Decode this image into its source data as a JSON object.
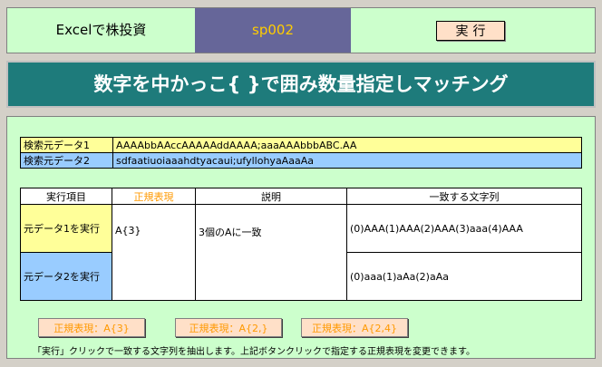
{
  "topbar": {
    "title": "Excelで株投資",
    "code": "sp002",
    "run_label": "実行"
  },
  "banner": {
    "title": "数字を中かっこ{ }で囲み数量指定しマッチング"
  },
  "source": {
    "rows": [
      {
        "label": "検索元データ1",
        "value": "AAAAbbAAccAAAAAddAAAA;aaaAAAbbbABC.AA"
      },
      {
        "label": "検索元データ2",
        "value": "sdfaatiuoiaaahdtyacaui;ufyllohyaAaaAa"
      }
    ]
  },
  "table": {
    "headers": [
      "実行項目",
      "正規表現",
      "説明",
      "一致する文字列"
    ],
    "rows": [
      {
        "run": "元データ1を実行",
        "regex": "A{3}",
        "desc": "3個のAに一致",
        "match": "(0)AAA(1)AAA(2)AAA(3)aaa(4)AAA"
      },
      {
        "run": "元データ2を実行",
        "regex": "",
        "desc": "",
        "match": "(0)aaa(1)aAa(2)aAa"
      }
    ]
  },
  "buttons": {
    "pattern1": "正規表現：A{3}",
    "pattern2": "正規表現：A{2,}",
    "pattern3": "正規表現：A{2,4}"
  },
  "footer": "「実行」クリックで一致する文字列を抽出します。上記ボタンクリックで指定する正規表現を変更できます。"
}
